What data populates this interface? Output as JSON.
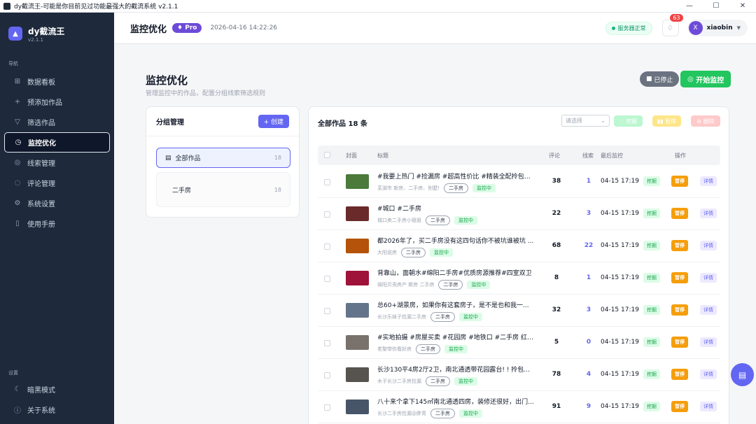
{
  "window": {
    "title": "dy截流王-可能是你目前见过功能最强大的截流系统 v2.1.1",
    "controls": [
      "—",
      "☐",
      "✕"
    ]
  },
  "brand": {
    "name": "dy截流王",
    "version": "v2.1.1"
  },
  "sidebar": {
    "nav_label": "导航",
    "items": [
      {
        "label": "数据看板",
        "icon": "chart-icon"
      },
      {
        "label": "预添加作品",
        "icon": "plus-icon"
      },
      {
        "label": "筛选作品",
        "icon": "filter-icon"
      },
      {
        "label": "监控优化",
        "icon": "monitor-icon",
        "active": true
      },
      {
        "label": "线索管理",
        "icon": "target-icon"
      },
      {
        "label": "评论管理",
        "icon": "comment-icon"
      },
      {
        "label": "系统设置",
        "icon": "gear-icon"
      },
      {
        "label": "使用手册",
        "icon": "book-icon"
      }
    ],
    "settings_label": "设置",
    "bottom_items": [
      {
        "label": "暗黑模式",
        "icon": "moon-icon"
      },
      {
        "label": "关于系统",
        "icon": "info-icon"
      }
    ]
  },
  "header": {
    "title": "监控优化",
    "badge": "Pro",
    "datetime": "2026-04-16 14:22:26",
    "server_status": "服务器正常",
    "notification_count": "63",
    "user_initial": "X",
    "username": "xiaobin"
  },
  "page": {
    "title": "监控优化",
    "subtitle": "管理监控中的作品，配置分组线索筛选规则",
    "stopped_label": "已停止",
    "start_label": "开始监控"
  },
  "groups": {
    "title": "分组管理",
    "create_label": "+ 创建",
    "items": [
      {
        "label": "全部作品",
        "count": "18"
      },
      {
        "label": "二手房",
        "count": "18"
      }
    ]
  },
  "works": {
    "title": "全部作品 18 条",
    "select_placeholder": "请选择",
    "bulk_dig": "挖掘",
    "bulk_pause": "暂停",
    "bulk_delete": "删除",
    "columns": {
      "cover": "封面",
      "title": "标题",
      "comments": "评论",
      "leads": "线索",
      "last_monitor": "最后监控",
      "actions": "操作"
    },
    "action_dig": "挖掘",
    "action_pause": "暂停",
    "action_detail": "详情",
    "rows": [
      {
        "title": "#我要上热门 #捡漏房 #超高性价比 #精装全配拎包入...",
        "author": "芜湖市 新房、二手房、别墅!",
        "category": "二手房",
        "status": "监控中",
        "comments": "38",
        "leads": "1",
        "last": "04-15 17:19",
        "thumb": "#4b7a3a"
      },
      {
        "title": "#城口 #二手房",
        "author": "城口卖二手房小姐姐",
        "category": "二手房",
        "status": "监控中",
        "comments": "22",
        "leads": "3",
        "last": "04-15 17:19",
        "thumb": "#6b2a2a"
      },
      {
        "title": "都2026年了，买二手房没有这四句话你不被坑谁被坑 ...",
        "author": "大阳说房",
        "category": "二手房",
        "status": "监控中",
        "comments": "68",
        "leads": "22",
        "last": "04-15 17:19",
        "thumb": "#b45309"
      },
      {
        "title": "背靠山，面朝水#绵阳二手房#优质房源推荐#四室双卫",
        "author": "绵阳贝壳房产 斯房 二手房",
        "category": "二手房",
        "status": "监控中",
        "comments": "8",
        "leads": "1",
        "last": "04-15 17:19",
        "thumb": "#9f1239"
      },
      {
        "title": "总60+湖景房，如果你有这套房子，是不是也和我一...",
        "author": "长沙乐妹子捡漏二手房",
        "category": "二手房",
        "status": "监控中",
        "comments": "32",
        "leads": "3",
        "last": "04-15 17:19",
        "thumb": "#64748b"
      },
      {
        "title": "#实地拍摄 #房屋买卖 #花园房 #地铁口 #二手房 红高...",
        "author": "老黎带你看好房",
        "category": "二手房",
        "status": "监控中",
        "comments": "5",
        "leads": "0",
        "last": "04-15 17:19",
        "thumb": "#78716c"
      },
      {
        "title": "长沙130平4房2厅2卫，南北通透带花园露台! ! 拎包...",
        "author": "木子长沙二手房捡漏",
        "category": "二手房",
        "status": "监控中",
        "comments": "78",
        "leads": "4",
        "last": "04-15 17:19",
        "thumb": "#57534e"
      },
      {
        "title": "八十来个拿下145㎡南北通透四房，装修还很好，出门...",
        "author": "长沙二手房捡漏@胖青",
        "category": "二手房",
        "status": "监控中",
        "comments": "91",
        "leads": "9",
        "last": "04-15 17:19",
        "thumb": "#475569"
      }
    ]
  }
}
